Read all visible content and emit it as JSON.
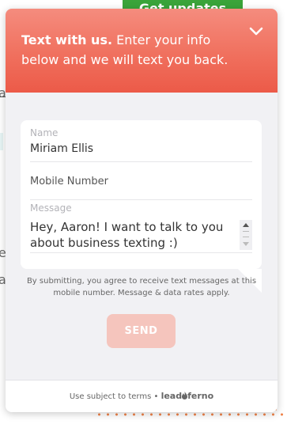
{
  "background": {
    "button_label": "Get updates",
    "left_letters": [
      "a",
      "e",
      "a"
    ]
  },
  "widget": {
    "header": {
      "bold_text": "Text with us.",
      "text": " Enter your info below and we will text you back.",
      "close_icon": "chevron-down-icon"
    },
    "form": {
      "name": {
        "label": "Name",
        "value": "Miriam Ellis"
      },
      "mobile": {
        "placeholder": "Mobile Number",
        "value": ""
      },
      "message": {
        "label": "Message",
        "value": "Hey, Aaron! I want to talk to you about business texting :)"
      }
    },
    "consent_text": "By submitting, you agree to receive text messages at this mobile number. Message & data rates apply.",
    "send_label": "SEND",
    "footer": {
      "terms_text": "Use subject to terms",
      "separator": "•",
      "brand_left": "lead",
      "brand_right": "ferno",
      "brand_icon": "flame-icon"
    }
  },
  "colors": {
    "header_top": "#f58c7e",
    "header_bottom": "#ec5a48",
    "send_button": "#f5c5bd",
    "accent_dots": "#f0844a",
    "bg_button": "#3aa43a"
  }
}
